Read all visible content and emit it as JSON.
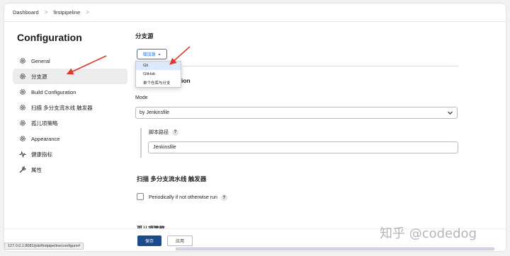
{
  "breadcrumb": {
    "items": [
      "Dashboard",
      "firstpipeline"
    ],
    "separator": ">"
  },
  "page": {
    "title": "Configuration"
  },
  "sidebar": {
    "items": [
      {
        "label": "General",
        "icon": "gear-icon",
        "active": false
      },
      {
        "label": "分支源",
        "icon": "gear-icon",
        "active": true
      },
      {
        "label": "Build Configuration",
        "icon": "gear-icon",
        "active": false
      },
      {
        "label": "扫描 多分支流水线 触发器",
        "icon": "gear-icon",
        "active": false
      },
      {
        "label": "孤儿项策略",
        "icon": "gear-icon",
        "active": false
      },
      {
        "label": "Appearance",
        "icon": "gear-icon",
        "active": false
      },
      {
        "label": "健康指标",
        "icon": "pulse-icon",
        "active": false
      },
      {
        "label": "属性",
        "icon": "wrench-icon",
        "active": false
      }
    ]
  },
  "branch_sources": {
    "title": "分支源",
    "add_button": "增加源",
    "dropdown_options": [
      "Git",
      "GitHub",
      "单个仓库与分支"
    ],
    "highlighted_option": "Git"
  },
  "build_config": {
    "title_visible_part": "ion",
    "mode_label": "Mode",
    "mode_value": "by Jenkinsfile",
    "script_path_label": "脚本路径",
    "script_path_value": "Jenkinsfile"
  },
  "scan_triggers": {
    "title": "扫描 多分支流水线 触发器",
    "periodic_label": "Periodically if not otherwise run",
    "periodic_checked": false
  },
  "orphan": {
    "title": "孤儿项策略"
  },
  "help_glyph": "?",
  "footer": {
    "save_label": "保存",
    "apply_label": "应用",
    "status_url": "127.0.0.1:8081/job/firstpipeline/configure#"
  },
  "watermark": "知乎 @codedog",
  "colors": {
    "accent": "#2e6fd3",
    "save_bg": "#1a4a8e",
    "arrow": "#d93a2b"
  }
}
